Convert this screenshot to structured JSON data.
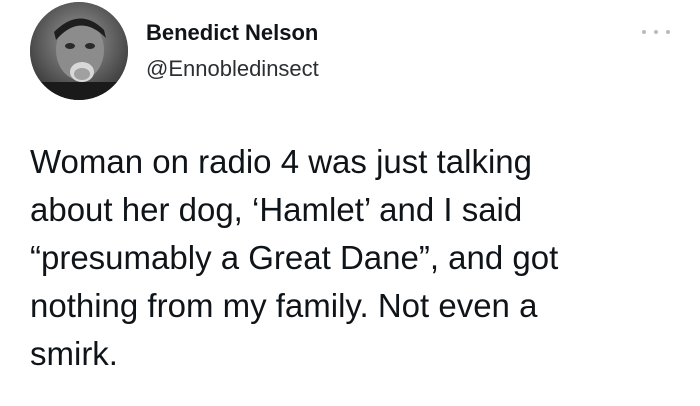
{
  "author": {
    "display_name": "Benedict Nelson",
    "handle": "@Ennobledinsect"
  },
  "tweet": {
    "text": "Woman on radio 4 was just talking\nabout her dog, ‘Hamlet’ and I said\n“presumably a Great Dane”, and got\nnothing from my family. Not even a\nsmirk."
  },
  "icons": {
    "more": "more-horizontal-icon"
  }
}
